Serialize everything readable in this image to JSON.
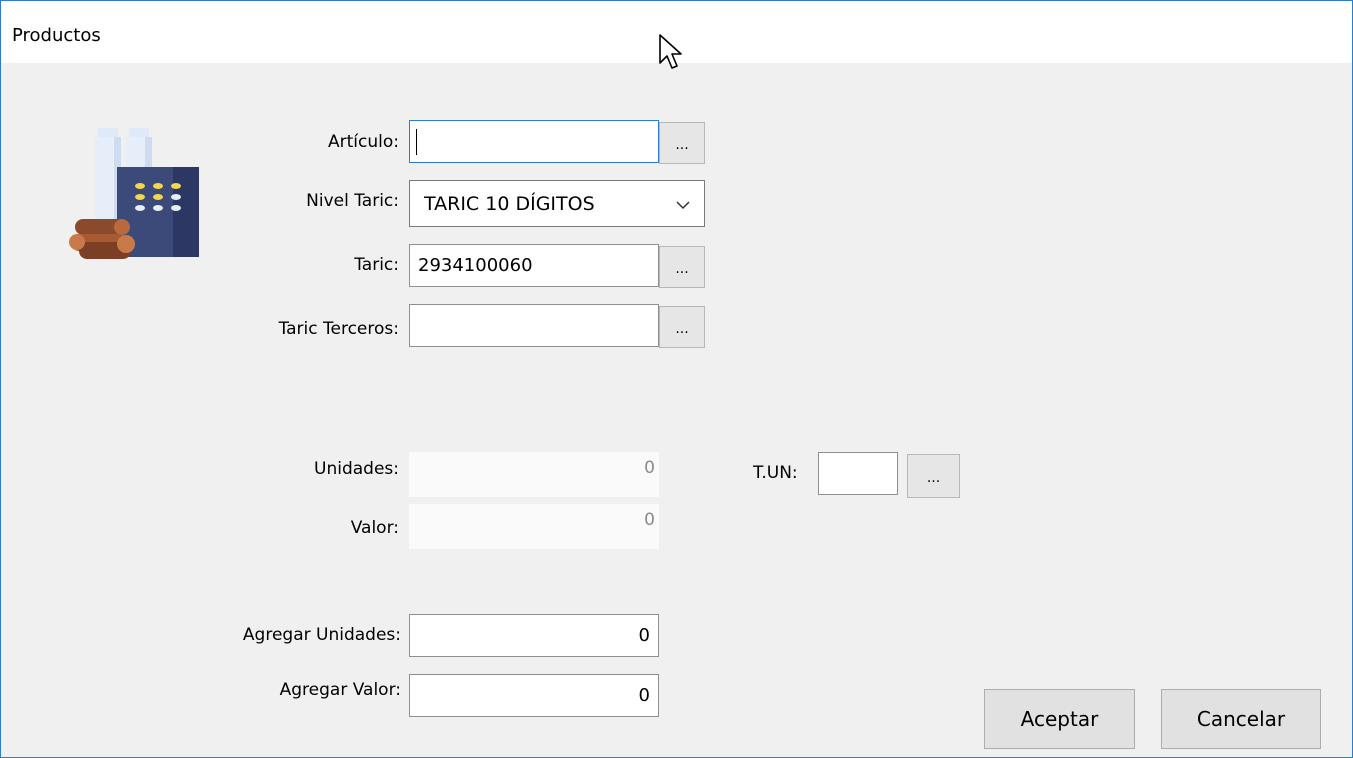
{
  "window": {
    "title": "Productos"
  },
  "form": {
    "articulo": {
      "label": "Artículo:",
      "value": "",
      "browse": "..."
    },
    "nivel_taric": {
      "label": "Nivel Taric:",
      "value": "TARIC 10 DÍGITOS"
    },
    "taric": {
      "label": "Taric:",
      "value": "2934100060",
      "browse": "..."
    },
    "taric_terceros": {
      "label": "Taric Terceros:",
      "value": "",
      "browse": "..."
    },
    "unidades": {
      "label": "Unidades:",
      "value": "0"
    },
    "valor": {
      "label": "Valor:",
      "value": "0"
    },
    "tun": {
      "label": "T.UN:",
      "value": "",
      "browse": "..."
    },
    "agregar_unidades": {
      "label": "Agregar Unidades:",
      "value": "0"
    },
    "agregar_valor": {
      "label": "Agregar Valor:",
      "value": "0"
    }
  },
  "buttons": {
    "accept": "Aceptar",
    "cancel": "Cancelar"
  },
  "icons": {
    "product": "factory-icon",
    "cursor": "mouse-pointer-icon"
  }
}
